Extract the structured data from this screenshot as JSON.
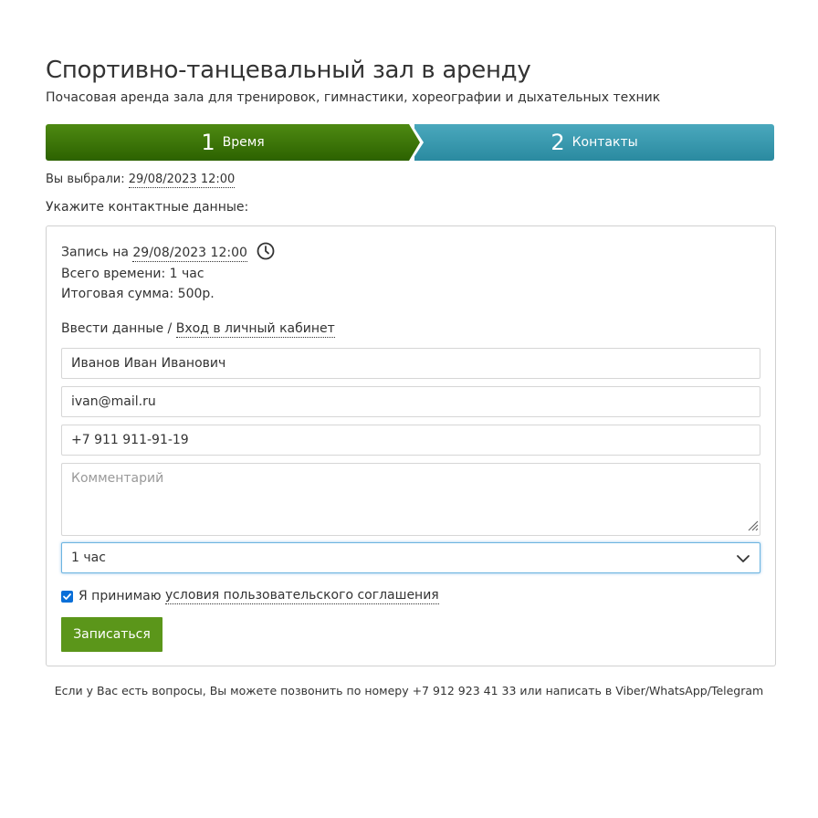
{
  "header": {
    "title": "Спортивно-танцевальный зал в аренду",
    "subtitle": "Почасовая аренда зала для тренировок, гимнастики, хореографии и дыхательных техник"
  },
  "steps": [
    {
      "number": "1",
      "label": "Время"
    },
    {
      "number": "2",
      "label": "Контакты"
    }
  ],
  "selection": {
    "prefix": "Вы выбрали:",
    "datetime": "29/08/2023 12:00"
  },
  "contacts_prompt": "Укажите контактные данные:",
  "booking": {
    "record_prefix": "Запись на",
    "datetime": "29/08/2023 12:00",
    "total_time": "Всего времени: 1 час",
    "total_sum": "Итоговая сумма: 500р."
  },
  "auth": {
    "enter_data": "Ввести данные /",
    "login_link": "Вход в личный кабинет"
  },
  "form": {
    "name_value": "Иванов Иван Иванович",
    "email_value": "ivan@mail.ru",
    "phone_value": "+7 911 911-91-19",
    "comment_placeholder": "Комментарий",
    "duration_selected": "1 час",
    "agree_prefix": "Я принимаю",
    "agree_link": "условия пользовательского соглашения",
    "agree_checked": true,
    "submit_label": "Записаться"
  },
  "footer_note": "Если у Вас есть вопросы, Вы можете позвонить по номеру +7 912 923 41 33 или написать в Viber/WhatsApp/Telegram",
  "colors": {
    "step_active": "#3a7509",
    "step_inactive": "#3399b0",
    "submit": "#5b961a",
    "checkbox": "#0a6fd8",
    "select_focus": "#6cb4e0"
  },
  "icons": {
    "clock": "clock-icon",
    "chevron": "chevron-down-icon",
    "check": "checkmark-icon",
    "grip": "resize-grip-icon"
  }
}
